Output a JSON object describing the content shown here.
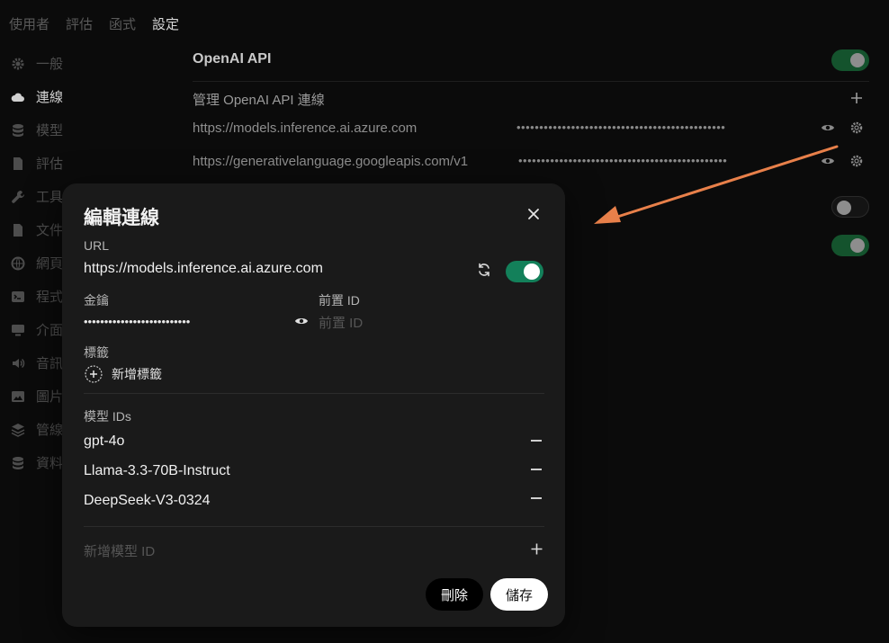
{
  "topnav": [
    "使用者",
    "評估",
    "函式",
    "設定"
  ],
  "sidebar": [
    {
      "label": "一般",
      "icon": "gear-icon"
    },
    {
      "label": "連線",
      "icon": "cloud-icon"
    },
    {
      "label": "模型",
      "icon": "database-icon"
    },
    {
      "label": "評估",
      "icon": "document-icon"
    },
    {
      "label": "工具",
      "icon": "wrench-icon"
    },
    {
      "label": "文件",
      "icon": "file-icon"
    },
    {
      "label": "網頁",
      "icon": "globe-icon"
    },
    {
      "label": "程式",
      "icon": "terminal-icon"
    },
    {
      "label": "介面",
      "icon": "monitor-icon"
    },
    {
      "label": "音訊",
      "icon": "speaker-icon"
    },
    {
      "label": "圖片",
      "icon": "image-icon"
    },
    {
      "label": "管線",
      "icon": "layers-icon"
    },
    {
      "label": "資料",
      "icon": "database-icon"
    }
  ],
  "settings": {
    "openai_label": "OpenAI API",
    "manage_label": "管理 OpenAI API 連線",
    "connections": [
      {
        "url": "https://models.inference.ai.azure.com",
        "key_mask": "••••••••••••••••••••••••••••••••••••••••••••••"
      },
      {
        "url": "https://generativelanguage.googleapis.com/v1",
        "key_mask": "••••••••••••••••••••••••••••••••••••••••••••••"
      }
    ]
  },
  "modal": {
    "title": "編輯連線",
    "url_label": "URL",
    "url_value": "https://models.inference.ai.azure.com",
    "key_label": "金鑰",
    "key_mask": "••••••••••••••••••••••••••",
    "prefix_label": "前置 ID",
    "prefix_placeholder": "前置 ID",
    "tags_label": "標籤",
    "add_tag": "新增標籤",
    "model_ids_label": "模型 IDs",
    "model_ids": [
      "gpt-4o",
      "Llama-3.3-70B-Instruct",
      "DeepSeek-V3-0324"
    ],
    "add_model_placeholder": "新增模型 ID",
    "delete_label": "刪除",
    "save_label": "儲存"
  },
  "colors": {
    "accent_toggle": "#13805a",
    "arrow": "#e8804a"
  }
}
